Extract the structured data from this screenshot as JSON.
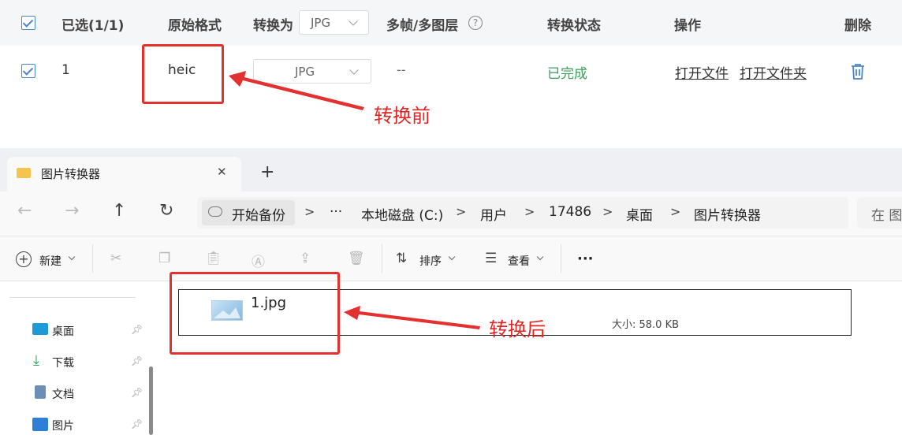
{
  "converter": {
    "header": {
      "selected": "已选(1/1)",
      "original_format": "原始格式",
      "convert_to": "转换为",
      "convert_to_select": "JPG",
      "multiframe": "多帧/多图层",
      "help_glyph": "?",
      "status": "转换状态",
      "actions": "操作",
      "delete": "删除"
    },
    "row": {
      "index": "1",
      "format": "heic",
      "target": "JPG",
      "multiframe": "--",
      "status": "已完成",
      "open_file": "打开文件",
      "open_folder": "打开文件夹"
    },
    "colors": {
      "status_done": "#3aa05a",
      "accent": "#4a86c8",
      "annotation": "#e53030"
    }
  },
  "annotations": {
    "before": "转换前",
    "after": "转换后"
  },
  "explorer": {
    "tab": {
      "title": "图片转换器",
      "close": "✕",
      "new_tab": "+"
    },
    "nav": {
      "back": "←",
      "forward": "→",
      "up": "↑",
      "refresh": "↻"
    },
    "address": {
      "backup": "开始备份",
      "ellipsis": "···",
      "crumbs": [
        "本地磁盘 (C:)",
        "用户",
        "17486",
        "桌面",
        "图片转换器"
      ],
      "separator": ">"
    },
    "search": {
      "placeholder": "在 图"
    },
    "toolbar": {
      "new": "新建",
      "sort": "排序",
      "view": "查看",
      "more": "···"
    },
    "sidebar": [
      {
        "label": "桌面",
        "icon": "desktop-icon"
      },
      {
        "label": "下载",
        "icon": "download-icon"
      },
      {
        "label": "文档",
        "icon": "document-icon"
      },
      {
        "label": "图片",
        "icon": "pictures-icon"
      }
    ],
    "file": {
      "name": "1.jpg",
      "size": "大小: 58.0 KB"
    }
  }
}
